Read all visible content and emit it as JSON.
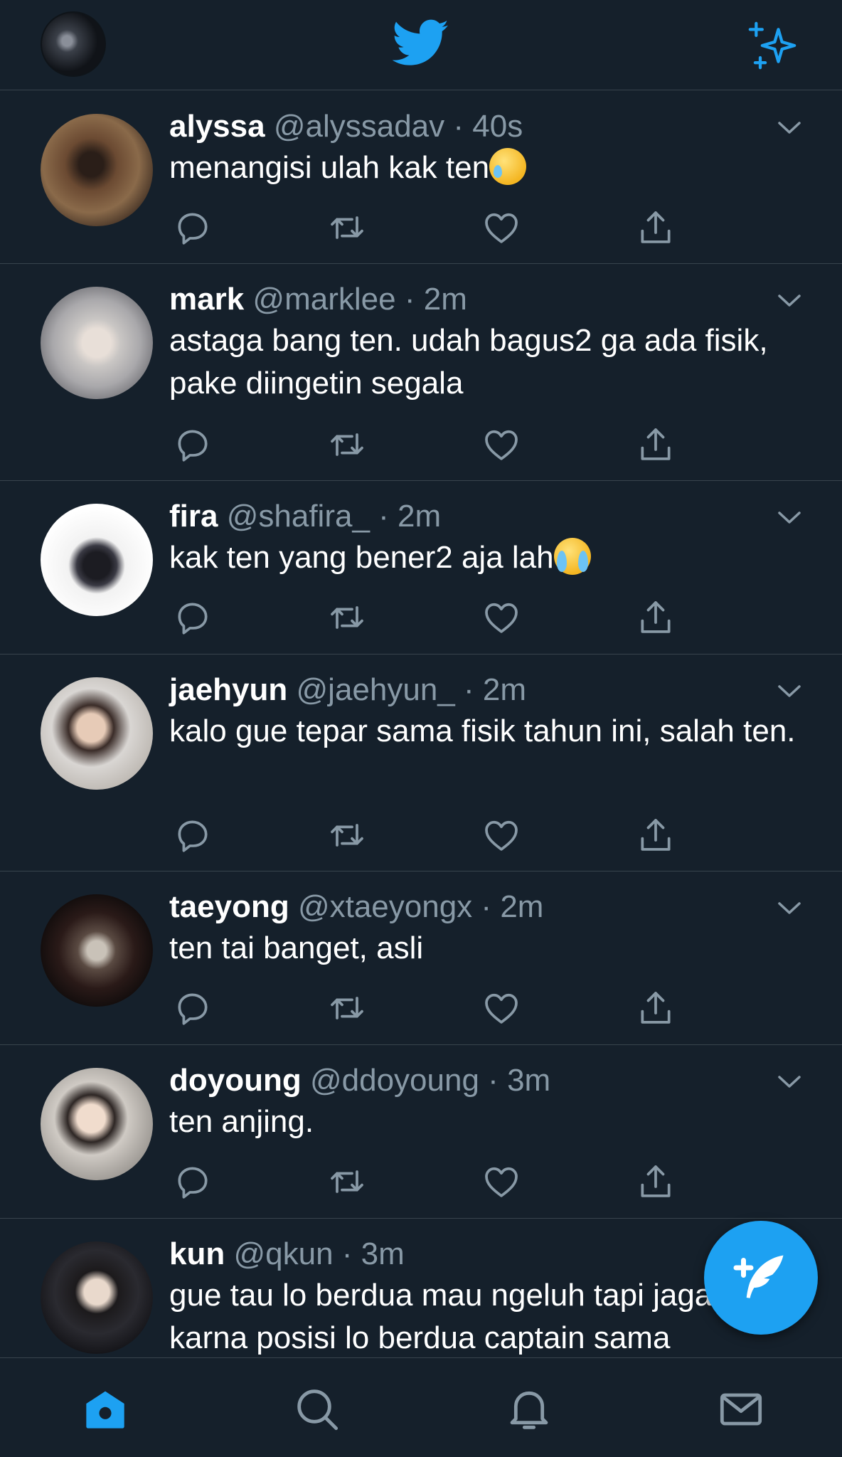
{
  "header": {
    "profile_avatar": "profile-avatar",
    "logo": "twitter-bird-icon",
    "timeline_toggle": "sparkle-icon"
  },
  "tweets": [
    {
      "name": "alyssa",
      "handle": "@alyssadav",
      "dot": "·",
      "time": "40s",
      "text": "menangisi ulah kak ten",
      "emoji": "smiling-face-with-tear"
    },
    {
      "name": "mark",
      "handle": "@marklee",
      "dot": "·",
      "time": "2m",
      "text": "astaga bang ten. udah bagus2 ga ada fisik, pake diingetin segala"
    },
    {
      "name": "fira",
      "handle": "@shafira_",
      "dot": "·",
      "time": "2m",
      "text": "kak ten yang bener2 aja lah",
      "emoji": "loudly-crying-face"
    },
    {
      "name": "jaehyun",
      "handle": "@jaehyun_",
      "dot": "·",
      "time": "2m",
      "text": "kalo gue tepar sama fisik tahun ini, salah ten."
    },
    {
      "name": "taeyong",
      "handle": "@xtaeyongx",
      "dot": "·",
      "time": "2m",
      "text": "ten tai banget, asli"
    },
    {
      "name": "doyoung",
      "handle": "@ddoyoung",
      "dot": "·",
      "time": "3m",
      "text": "ten anjing."
    },
    {
      "name": "kun",
      "handle": "@qkun",
      "dot": "·",
      "time": "3m",
      "text": "gue tau lo berdua mau ngeluh tapi jaga image karna posisi lo berdua captain sama"
    }
  ],
  "actions": [
    "reply-icon",
    "retweet-icon",
    "like-icon",
    "share-icon"
  ],
  "compose_button": "compose-tweet-icon",
  "bottom_nav": [
    "home-icon",
    "search-icon",
    "notifications-icon",
    "messages-icon"
  ],
  "colors": {
    "background": "#15202b",
    "accent": "#1da1f2",
    "secondary_text": "#8899a6",
    "divider": "#38444d"
  }
}
